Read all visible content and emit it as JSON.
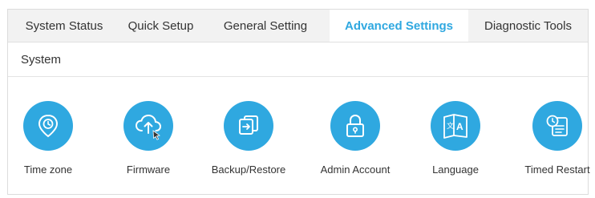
{
  "tabs": [
    {
      "label": "System Status",
      "active": false
    },
    {
      "label": "Quick Setup",
      "active": false
    },
    {
      "label": "General Setting",
      "active": false
    },
    {
      "label": "Advanced Settings",
      "active": true
    },
    {
      "label": "Diagnostic Tools",
      "active": false
    }
  ],
  "section": {
    "title": "System"
  },
  "items": [
    {
      "label": "Time zone",
      "icon": "clock-pin-icon"
    },
    {
      "label": "Firmware",
      "icon": "cloud-upload-icon"
    },
    {
      "label": "Backup/Restore",
      "icon": "backup-restore-icon"
    },
    {
      "label": "Admin Account",
      "icon": "lock-icon"
    },
    {
      "label": "Language",
      "icon": "language-book-icon"
    },
    {
      "label": "Timed Restart",
      "icon": "timed-restart-icon"
    }
  ],
  "colors": {
    "accent": "#2fa8e0",
    "tab_bar_bg": "#f2f2f2",
    "text": "#333333"
  }
}
